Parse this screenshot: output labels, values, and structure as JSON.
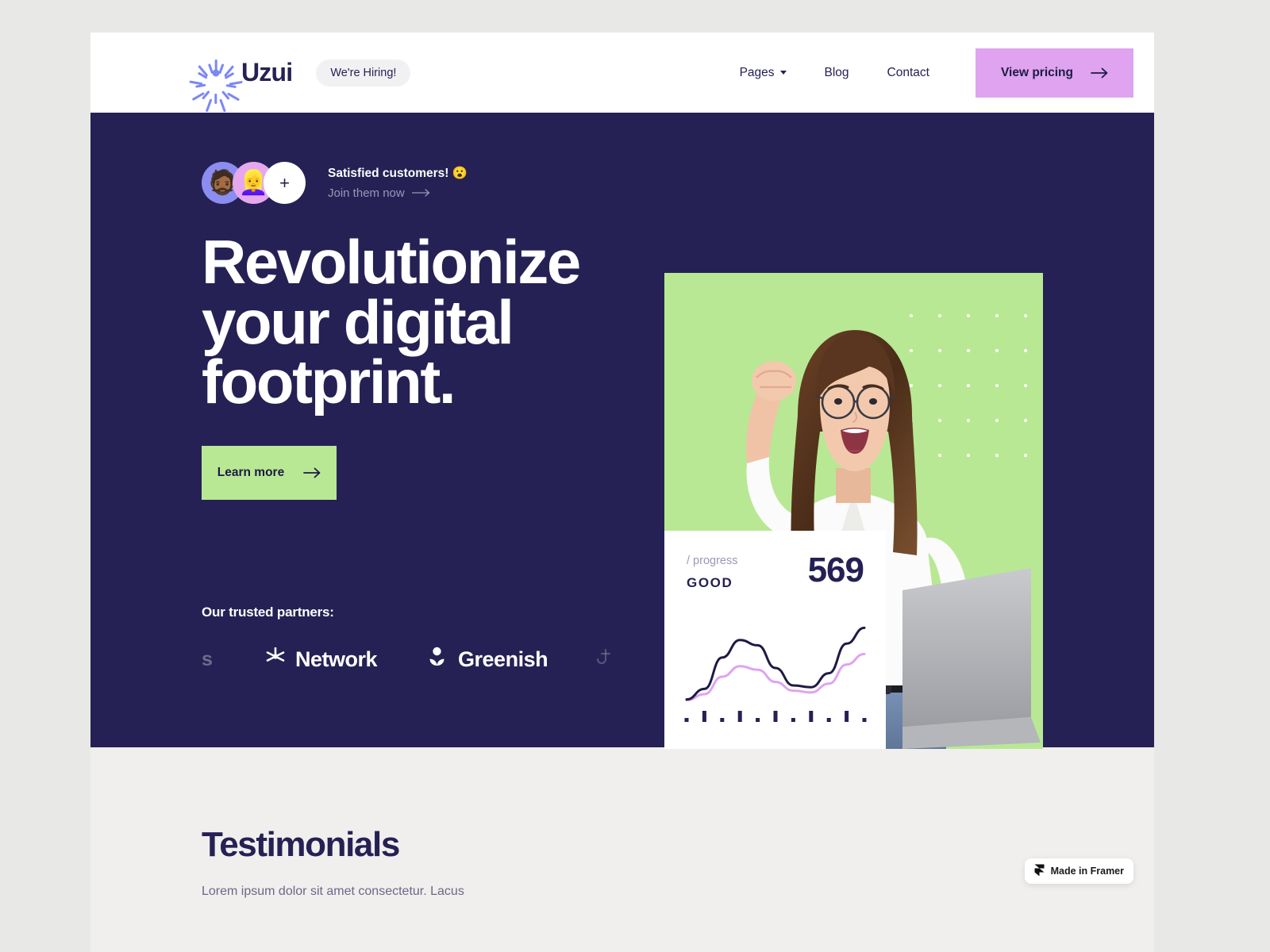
{
  "header": {
    "brand_name": "Uzui",
    "logo_icon": "starburst-icon",
    "hiring_badge": "We're Hiring!",
    "nav": [
      {
        "label": "Pages",
        "has_dropdown": true
      },
      {
        "label": "Blog",
        "has_dropdown": false
      },
      {
        "label": "Contact",
        "has_dropdown": false
      }
    ],
    "cta": {
      "label": "View pricing",
      "icon": "arrow-right-icon",
      "bg": "#dfa3f0"
    }
  },
  "hero": {
    "bg": "#252154",
    "social_proof": {
      "avatars": [
        "🧔🏾",
        "👱‍♀️",
        "+"
      ],
      "title": "Satisfied customers! 😮",
      "subtitle": "Join them now",
      "subtitle_icon": "arrow-right-icon"
    },
    "headline": {
      "line1": "Revolutionize",
      "line2_pre": "your ",
      "line2_mark": "digital",
      "line3": "footprint.",
      "highlight_color": "#7b87f5"
    },
    "cta": {
      "label": "Learn more",
      "icon": "arrow-right-icon",
      "bg": "#b8e894"
    },
    "partners": {
      "label": "Our trusted partners:",
      "items": [
        {
          "name": "s",
          "icon": "partial-logo-icon",
          "partial": true
        },
        {
          "name": "Network",
          "icon": "star-burst-icon",
          "partial": false
        },
        {
          "name": "Greenish",
          "icon": "leaf-person-icon",
          "partial": false
        },
        {
          "name": "",
          "icon": "partial-logo-icon",
          "partial": true
        }
      ]
    },
    "image": {
      "alt": "woman-celebrating-with-laptop",
      "bg": "#b8e894",
      "dot_pattern": "white-dot-grid"
    },
    "stat_card": {
      "label": "/ progress",
      "status": "GOOD",
      "value": "569"
    }
  },
  "chart_data": {
    "type": "line",
    "title": "",
    "xlabel": "",
    "ylabel": "",
    "grid": false,
    "legend": "none",
    "x": [
      0,
      1,
      2,
      3,
      4,
      5,
      6,
      7,
      8,
      9,
      10
    ],
    "xlim": [
      0,
      10
    ],
    "ylim": [
      0,
      100
    ],
    "axis_ticks": {
      "count": 11,
      "pattern": [
        "small",
        "tall",
        "small",
        "tall",
        "small",
        "tall",
        "small",
        "tall",
        "small",
        "tall",
        "small"
      ],
      "color": "#252154"
    },
    "series": [
      {
        "name": "primary",
        "color": "#1d1b44",
        "width": 3,
        "values": [
          4,
          16,
          52,
          72,
          66,
          40,
          20,
          18,
          34,
          68,
          86
        ]
      },
      {
        "name": "secondary",
        "color": "#dfa3f0",
        "width": 3,
        "values": [
          3,
          10,
          30,
          42,
          38,
          24,
          14,
          12,
          22,
          44,
          56
        ]
      }
    ]
  },
  "testimonials": {
    "title": "Testimonials",
    "subtitle": "Lorem ipsum dolor sit amet consectetur. Lacus"
  },
  "framer_badge": {
    "label": "Made in Framer",
    "icon": "framer-logo-icon"
  }
}
